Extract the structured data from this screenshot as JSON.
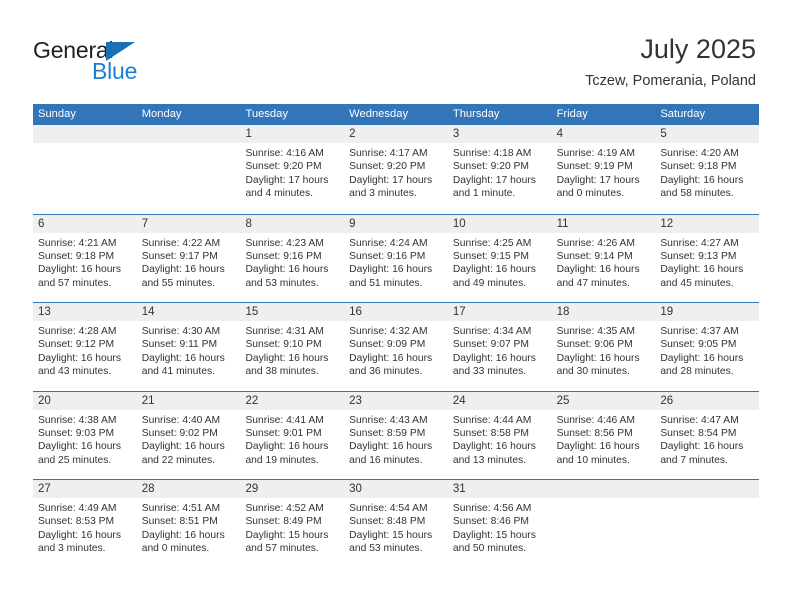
{
  "brand": {
    "name_top": "General",
    "name_bottom": "Blue",
    "triangle_color": "#1c6fb4",
    "blue_color": "#1c7fd4",
    "dark_color": "#231f20"
  },
  "header": {
    "title": "July 2025",
    "subtitle": "Tczew, Pomerania, Poland"
  },
  "theme": {
    "accent": "#3275b8",
    "daynum_band": "#efefef",
    "text": "#333333",
    "background": "#ffffff"
  },
  "weekdays": [
    "Sunday",
    "Monday",
    "Tuesday",
    "Wednesday",
    "Thursday",
    "Friday",
    "Saturday"
  ],
  "weeks": [
    [
      {
        "day": "",
        "sunrise": "",
        "sunset": "",
        "daylight": "",
        "empty": true
      },
      {
        "day": "",
        "sunrise": "",
        "sunset": "",
        "daylight": "",
        "empty": true
      },
      {
        "day": "1",
        "sunrise": "Sunrise: 4:16 AM",
        "sunset": "Sunset: 9:20 PM",
        "daylight": "Daylight: 17 hours and 4 minutes."
      },
      {
        "day": "2",
        "sunrise": "Sunrise: 4:17 AM",
        "sunset": "Sunset: 9:20 PM",
        "daylight": "Daylight: 17 hours and 3 minutes."
      },
      {
        "day": "3",
        "sunrise": "Sunrise: 4:18 AM",
        "sunset": "Sunset: 9:20 PM",
        "daylight": "Daylight: 17 hours and 1 minute."
      },
      {
        "day": "4",
        "sunrise": "Sunrise: 4:19 AM",
        "sunset": "Sunset: 9:19 PM",
        "daylight": "Daylight: 17 hours and 0 minutes."
      },
      {
        "day": "5",
        "sunrise": "Sunrise: 4:20 AM",
        "sunset": "Sunset: 9:18 PM",
        "daylight": "Daylight: 16 hours and 58 minutes."
      }
    ],
    [
      {
        "day": "6",
        "sunrise": "Sunrise: 4:21 AM",
        "sunset": "Sunset: 9:18 PM",
        "daylight": "Daylight: 16 hours and 57 minutes."
      },
      {
        "day": "7",
        "sunrise": "Sunrise: 4:22 AM",
        "sunset": "Sunset: 9:17 PM",
        "daylight": "Daylight: 16 hours and 55 minutes."
      },
      {
        "day": "8",
        "sunrise": "Sunrise: 4:23 AM",
        "sunset": "Sunset: 9:16 PM",
        "daylight": "Daylight: 16 hours and 53 minutes."
      },
      {
        "day": "9",
        "sunrise": "Sunrise: 4:24 AM",
        "sunset": "Sunset: 9:16 PM",
        "daylight": "Daylight: 16 hours and 51 minutes."
      },
      {
        "day": "10",
        "sunrise": "Sunrise: 4:25 AM",
        "sunset": "Sunset: 9:15 PM",
        "daylight": "Daylight: 16 hours and 49 minutes."
      },
      {
        "day": "11",
        "sunrise": "Sunrise: 4:26 AM",
        "sunset": "Sunset: 9:14 PM",
        "daylight": "Daylight: 16 hours and 47 minutes."
      },
      {
        "day": "12",
        "sunrise": "Sunrise: 4:27 AM",
        "sunset": "Sunset: 9:13 PM",
        "daylight": "Daylight: 16 hours and 45 minutes."
      }
    ],
    [
      {
        "day": "13",
        "sunrise": "Sunrise: 4:28 AM",
        "sunset": "Sunset: 9:12 PM",
        "daylight": "Daylight: 16 hours and 43 minutes."
      },
      {
        "day": "14",
        "sunrise": "Sunrise: 4:30 AM",
        "sunset": "Sunset: 9:11 PM",
        "daylight": "Daylight: 16 hours and 41 minutes."
      },
      {
        "day": "15",
        "sunrise": "Sunrise: 4:31 AM",
        "sunset": "Sunset: 9:10 PM",
        "daylight": "Daylight: 16 hours and 38 minutes."
      },
      {
        "day": "16",
        "sunrise": "Sunrise: 4:32 AM",
        "sunset": "Sunset: 9:09 PM",
        "daylight": "Daylight: 16 hours and 36 minutes."
      },
      {
        "day": "17",
        "sunrise": "Sunrise: 4:34 AM",
        "sunset": "Sunset: 9:07 PM",
        "daylight": "Daylight: 16 hours and 33 minutes."
      },
      {
        "day": "18",
        "sunrise": "Sunrise: 4:35 AM",
        "sunset": "Sunset: 9:06 PM",
        "daylight": "Daylight: 16 hours and 30 minutes."
      },
      {
        "day": "19",
        "sunrise": "Sunrise: 4:37 AM",
        "sunset": "Sunset: 9:05 PM",
        "daylight": "Daylight: 16 hours and 28 minutes."
      }
    ],
    [
      {
        "day": "20",
        "sunrise": "Sunrise: 4:38 AM",
        "sunset": "Sunset: 9:03 PM",
        "daylight": "Daylight: 16 hours and 25 minutes."
      },
      {
        "day": "21",
        "sunrise": "Sunrise: 4:40 AM",
        "sunset": "Sunset: 9:02 PM",
        "daylight": "Daylight: 16 hours and 22 minutes."
      },
      {
        "day": "22",
        "sunrise": "Sunrise: 4:41 AM",
        "sunset": "Sunset: 9:01 PM",
        "daylight": "Daylight: 16 hours and 19 minutes."
      },
      {
        "day": "23",
        "sunrise": "Sunrise: 4:43 AM",
        "sunset": "Sunset: 8:59 PM",
        "daylight": "Daylight: 16 hours and 16 minutes."
      },
      {
        "day": "24",
        "sunrise": "Sunrise: 4:44 AM",
        "sunset": "Sunset: 8:58 PM",
        "daylight": "Daylight: 16 hours and 13 minutes."
      },
      {
        "day": "25",
        "sunrise": "Sunrise: 4:46 AM",
        "sunset": "Sunset: 8:56 PM",
        "daylight": "Daylight: 16 hours and 10 minutes."
      },
      {
        "day": "26",
        "sunrise": "Sunrise: 4:47 AM",
        "sunset": "Sunset: 8:54 PM",
        "daylight": "Daylight: 16 hours and 7 minutes."
      }
    ],
    [
      {
        "day": "27",
        "sunrise": "Sunrise: 4:49 AM",
        "sunset": "Sunset: 8:53 PM",
        "daylight": "Daylight: 16 hours and 3 minutes."
      },
      {
        "day": "28",
        "sunrise": "Sunrise: 4:51 AM",
        "sunset": "Sunset: 8:51 PM",
        "daylight": "Daylight: 16 hours and 0 minutes."
      },
      {
        "day": "29",
        "sunrise": "Sunrise: 4:52 AM",
        "sunset": "Sunset: 8:49 PM",
        "daylight": "Daylight: 15 hours and 57 minutes."
      },
      {
        "day": "30",
        "sunrise": "Sunrise: 4:54 AM",
        "sunset": "Sunset: 8:48 PM",
        "daylight": "Daylight: 15 hours and 53 minutes."
      },
      {
        "day": "31",
        "sunrise": "Sunrise: 4:56 AM",
        "sunset": "Sunset: 8:46 PM",
        "daylight": "Daylight: 15 hours and 50 minutes."
      },
      {
        "day": "",
        "sunrise": "",
        "sunset": "",
        "daylight": "",
        "empty": true
      },
      {
        "day": "",
        "sunrise": "",
        "sunset": "",
        "daylight": "",
        "empty": true
      }
    ]
  ]
}
